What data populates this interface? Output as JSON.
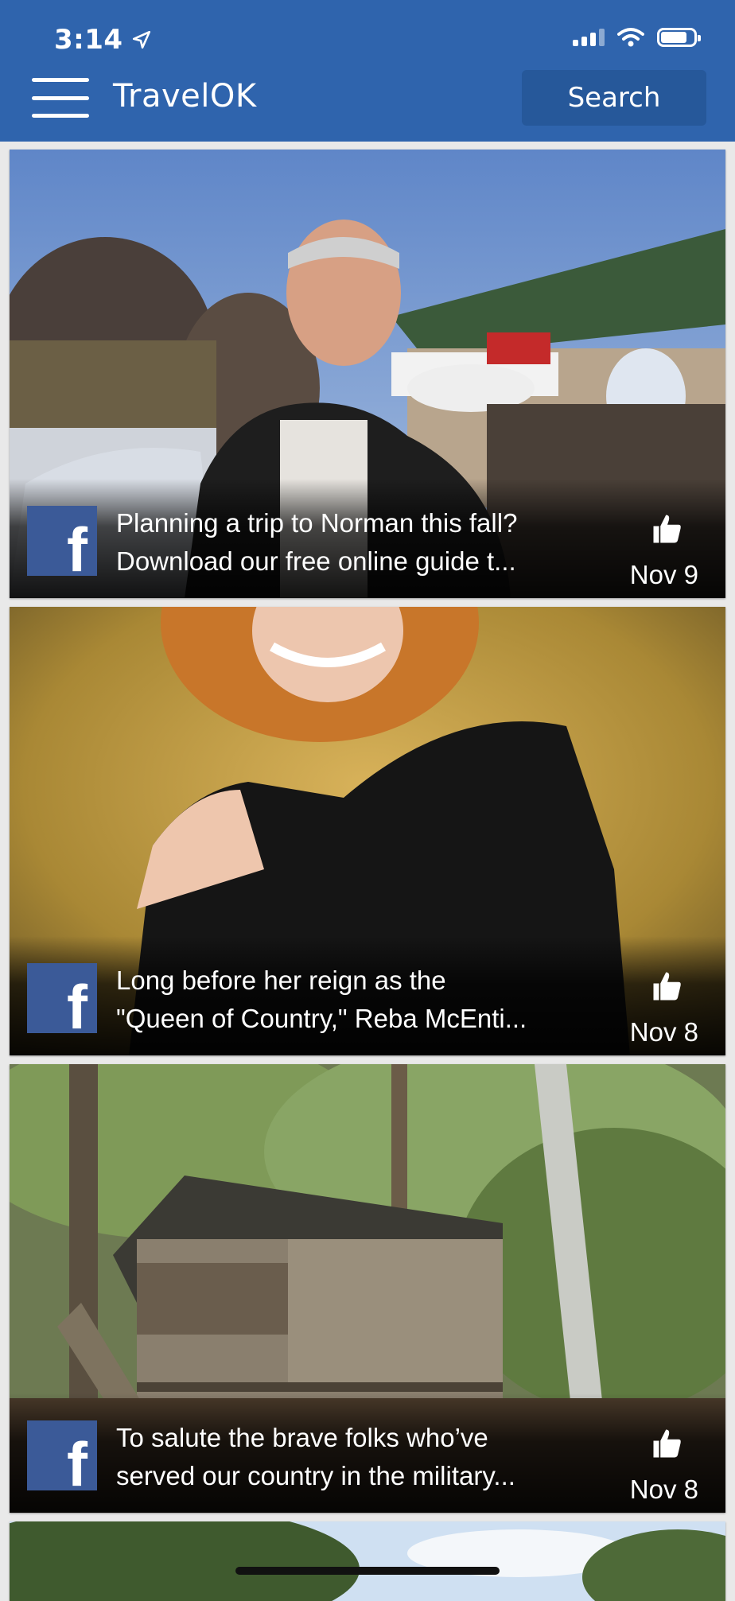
{
  "theme": {
    "brand": "#2f64ad",
    "facebook": "#3b5a98"
  },
  "status_bar": {
    "time": "3:14",
    "location_icon": "location-arrow-icon",
    "signal_icon": "cellular-signal-icon",
    "wifi_icon": "wifi-icon",
    "battery_icon": "battery-icon"
  },
  "header": {
    "menu_icon": "hamburger-menu-icon",
    "title": "TravelOK",
    "search_label": "Search"
  },
  "feed": {
    "posts": [
      {
        "source_icon": "facebook-icon",
        "line1": "Planning a trip to Norman this fall?",
        "line2": "Download our free online guide t...",
        "like_icon": "thumbs-up-icon",
        "date": "Nov 9"
      },
      {
        "source_icon": "facebook-icon",
        "line1": "Long before her reign as the",
        "line2": "\"Queen of Country,\" Reba McEnti...",
        "like_icon": "thumbs-up-icon",
        "date": "Nov 8"
      },
      {
        "source_icon": "facebook-icon",
        "line1": "To salute the brave folks who’ve",
        "line2": "served our country in the military...",
        "like_icon": "thumbs-up-icon",
        "date": "Nov 8"
      }
    ]
  }
}
